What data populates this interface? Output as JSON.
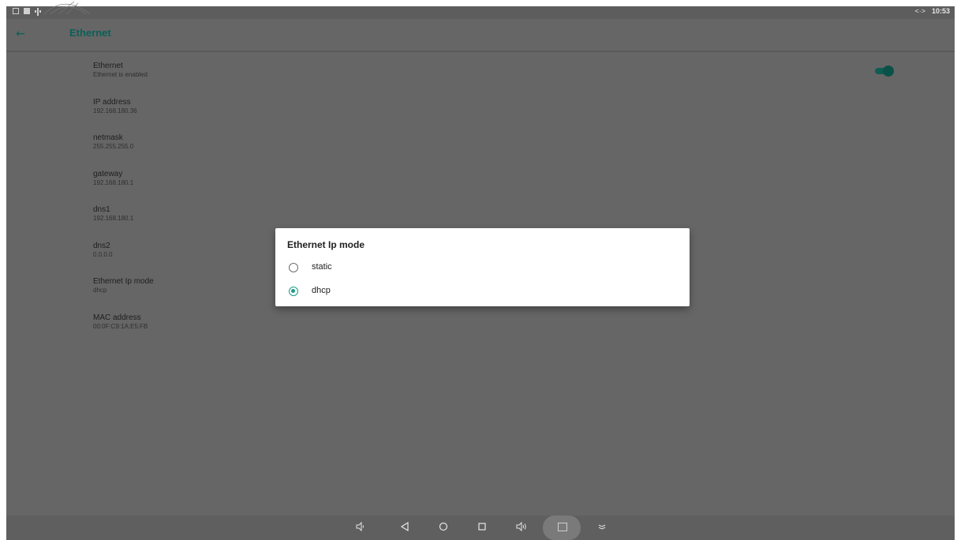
{
  "status_bar": {
    "time": "10:53",
    "network_indicator": "<·>"
  },
  "app_bar": {
    "title": "Ethernet",
    "back_icon": "arrow-left-icon"
  },
  "preferences": [
    {
      "title": "Ethernet",
      "summary": "Ethernet is enabled"
    },
    {
      "title": "IP address",
      "summary": "192.168.180.36"
    },
    {
      "title": "netmask",
      "summary": "255.255.255.0"
    },
    {
      "title": "gateway",
      "summary": "192.168.180.1"
    },
    {
      "title": "dns1",
      "summary": "192.168.180.1"
    },
    {
      "title": "dns2",
      "summary": "0.0.0.0"
    },
    {
      "title": "Ethernet Ip mode",
      "summary": "dhcp"
    },
    {
      "title": "MAC address",
      "summary": "00:0F:C9:1A:E5:FB"
    }
  ],
  "toggle": {
    "state": "on",
    "accent_color": "#0f5c52"
  },
  "dialog": {
    "title": "Ethernet Ip mode",
    "options": [
      {
        "label": "static",
        "checked": false
      },
      {
        "label": "dhcp",
        "checked": true
      }
    ],
    "accent_color": "#1a9c86"
  },
  "nav_bar": {
    "buttons": [
      "volume-down-icon",
      "back-triangle-icon",
      "home-circle-icon",
      "recents-square-icon",
      "volume-up-icon",
      "screenshot-icon",
      "expand-chevron-icon"
    ]
  }
}
